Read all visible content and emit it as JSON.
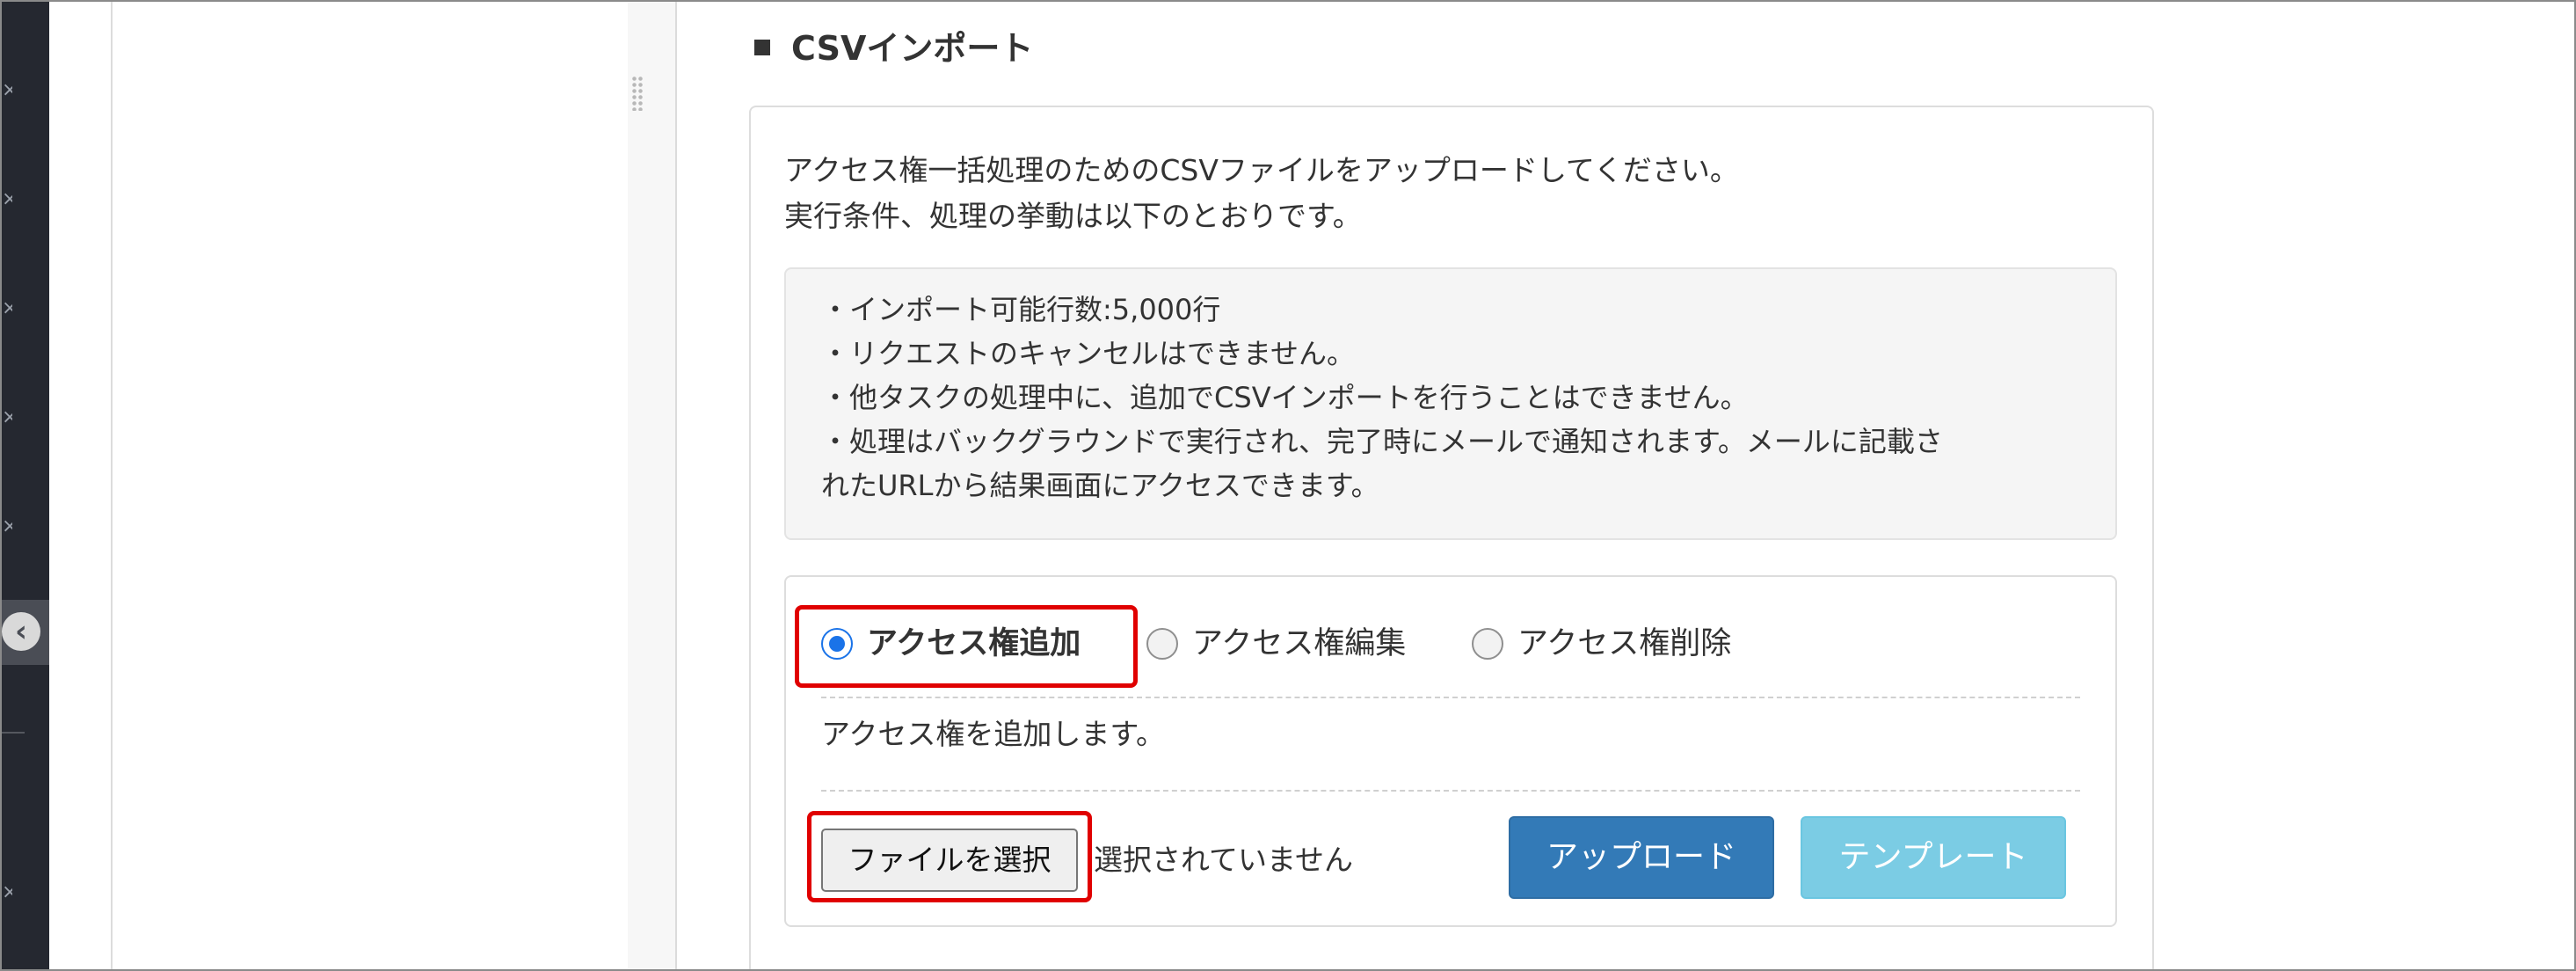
{
  "section": {
    "title": "CSVインポート"
  },
  "intro": {
    "line1": "アクセス権一括処理のためのCSVファイルをアップロードしてください。",
    "line2": "実行条件、処理の挙動は以下のとおりです。"
  },
  "notes": [
    "・インポート可能行数:5,000行",
    "・リクエストのキャンセルはできません。",
    "・他タスクの処理中に、追加でCSVインポートを行うことはできません。",
    "・処理はバックグラウンドで実行され、完了時にメールで通知されます。メールに記載さ",
    "れたURLから結果画面にアクセスできます。"
  ],
  "operation": {
    "selected": "add",
    "options": {
      "add": "アクセス権追加",
      "edit": "アクセス権編集",
      "delete": "アクセス権削除"
    },
    "description": "アクセス権を追加します。"
  },
  "file": {
    "button_label": "ファイルを選択",
    "status": "選択されていません"
  },
  "buttons": {
    "upload": "アップロード",
    "template": "テンプレート"
  },
  "colors": {
    "upload_button": "#337ab7",
    "template_button": "#5bc0de",
    "highlight_box": "#e00000",
    "radio_selected": "#1a73e8",
    "sidebar": "#252830"
  },
  "icons": {
    "sidebar_back": "arrow-left-circle-icon",
    "splitter": "drag-handle-icon"
  }
}
